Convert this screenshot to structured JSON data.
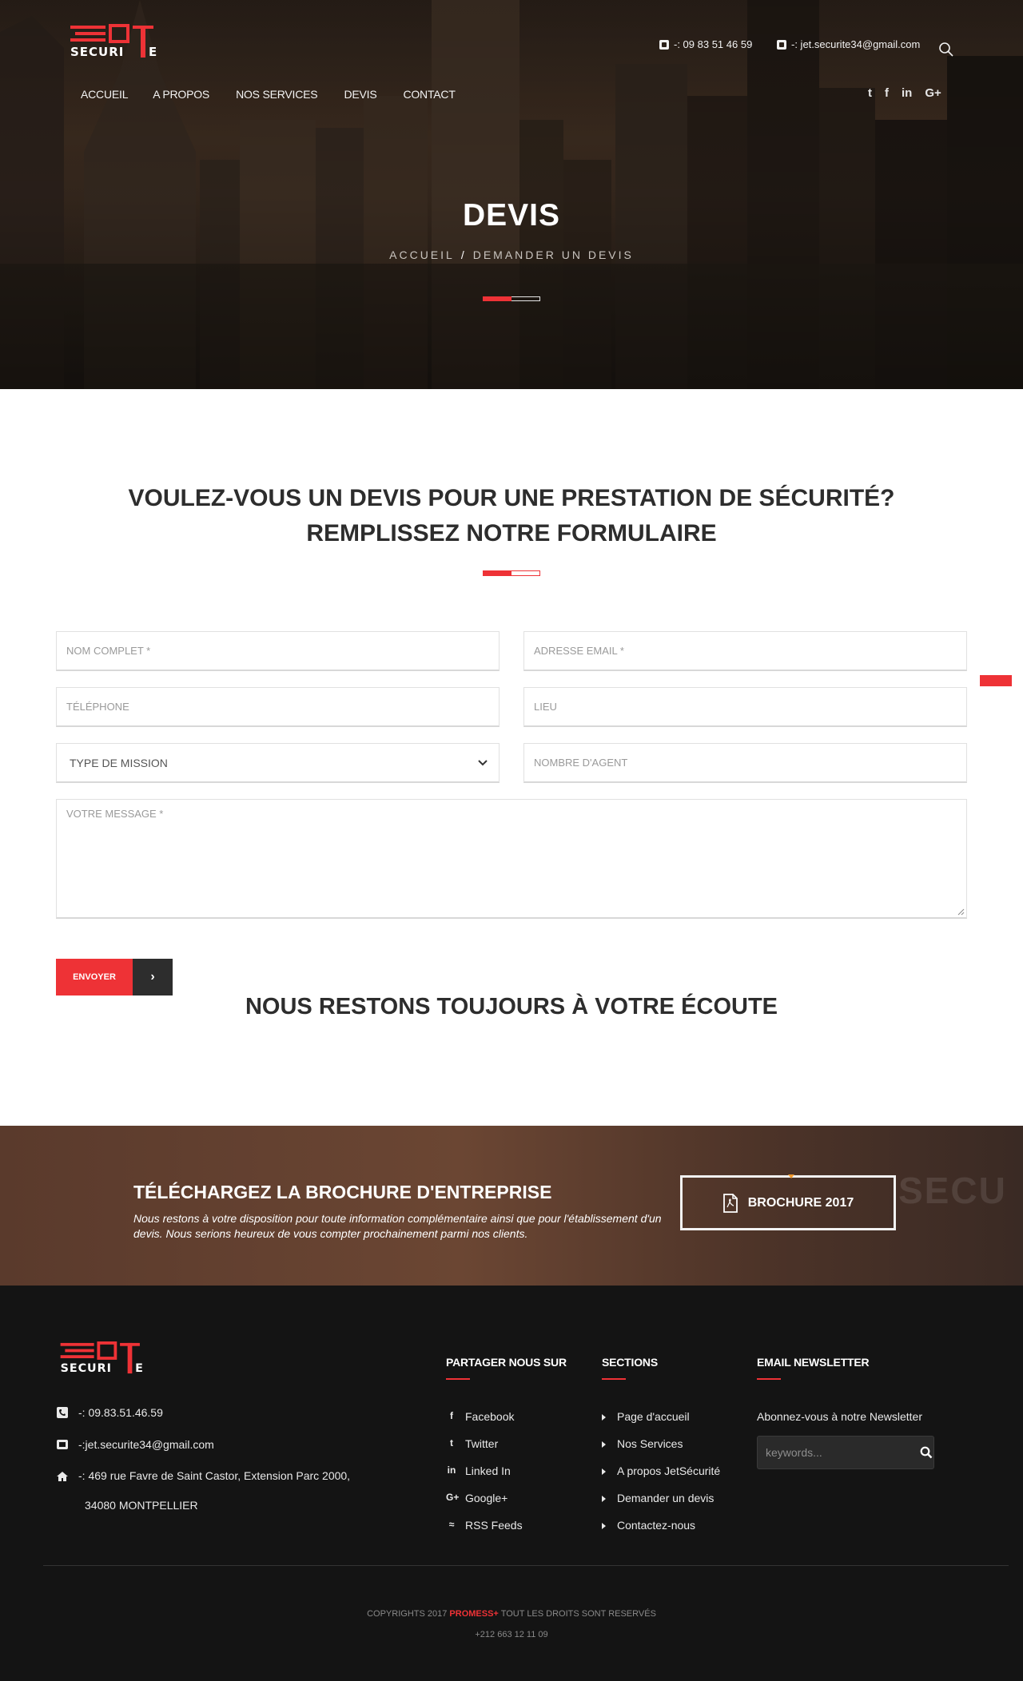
{
  "brand": {
    "logo_top": "JET",
    "logo_bottom": "SECURITE",
    "accent": "#ee3236",
    "dark": "#2d2d2d"
  },
  "header": {
    "phone": "-: 09 83 51 46 59",
    "email": "-: jet.securite34@gmail.com",
    "nav": [
      "ACCUEIL",
      "A PROPOS",
      "NOS SERVICES",
      "DEVIS",
      "CONTACT"
    ],
    "social_icons": [
      "twitter-icon",
      "facebook-icon",
      "linkedin-icon",
      "google-plus-icon"
    ],
    "social_glyphs": {
      "twitter": "t",
      "facebook": "f",
      "linkedin": "in",
      "googleplus": "G+"
    }
  },
  "hero": {
    "title": "DEVIS",
    "crumb_home": "ACCUEIL",
    "crumb_sep": "/",
    "crumb_current": "DEMANDER UN DEVIS"
  },
  "form": {
    "title_line1": "VOULEZ-VOUS UN DEVIS POUR UNE PRESTATION DE SÉCURITÉ?",
    "title_line2": "REMPLISSEZ NOTRE FORMULAIRE",
    "name_placeholder": "NOM COMPLET *",
    "email_placeholder": "ADRESSE EMAIL *",
    "phone_placeholder": "TÉLÉPHONE",
    "place_placeholder": "LIEU",
    "mission_selected": "TYPE DE MISSION",
    "agents_placeholder": "NOMBRE D'AGENT",
    "message_placeholder": "VOTRE MESSAGE *",
    "submit_label": "ENVOYER",
    "submit_arrow": "›"
  },
  "listen_title": "NOUS RESTONS TOUJOURS À VOTRE ÉCOUTE",
  "brochure": {
    "title": "TÉLÉCHARGEZ LA BROCHURE D'ENTREPRISE",
    "text": "Nous restons à votre disposition pour toute information complémentaire ainsi que pour l'établissement d'un devis. Nous serions heureux de vous compter prochainement parmi nos clients.",
    "button_label": "BROCHURE 2017",
    "watermark": "SECU"
  },
  "footer": {
    "phone": "-: 09.83.51.46.59",
    "email": "-:jet.securite34@gmail.com",
    "address_line1": "-: 469 rue Favre de Saint Castor, Extension Parc 2000,",
    "address_line2": "34080 MONTPELLIER",
    "share_title": "PARTAGER NOUS SUR",
    "share": [
      {
        "icon": "f",
        "label": "Facebook"
      },
      {
        "icon": "t",
        "label": "Twitter"
      },
      {
        "icon": "in",
        "label": "Linked In"
      },
      {
        "icon": "G+",
        "label": "Google+"
      },
      {
        "icon": "≈",
        "label": "RSS Feeds"
      }
    ],
    "sections_title": "SECTIONS",
    "sections": [
      "Page d'accueil",
      "Nos Services",
      "A propos JetSécurité",
      "Demander un devis",
      "Contactez-nous"
    ],
    "newsletter_title": "EMAIL NEWSLETTER",
    "newsletter_text": "Abonnez-vous à notre Newsletter",
    "newsletter_placeholder": "keywords...",
    "copyright_pre": "COPYRIGHTS 2017",
    "copyright_brand": "PROMESS+",
    "copyright_post": "TOUT LES DROITS SONT RESERVÉS",
    "phone2": "+212 663 12 11 09"
  }
}
